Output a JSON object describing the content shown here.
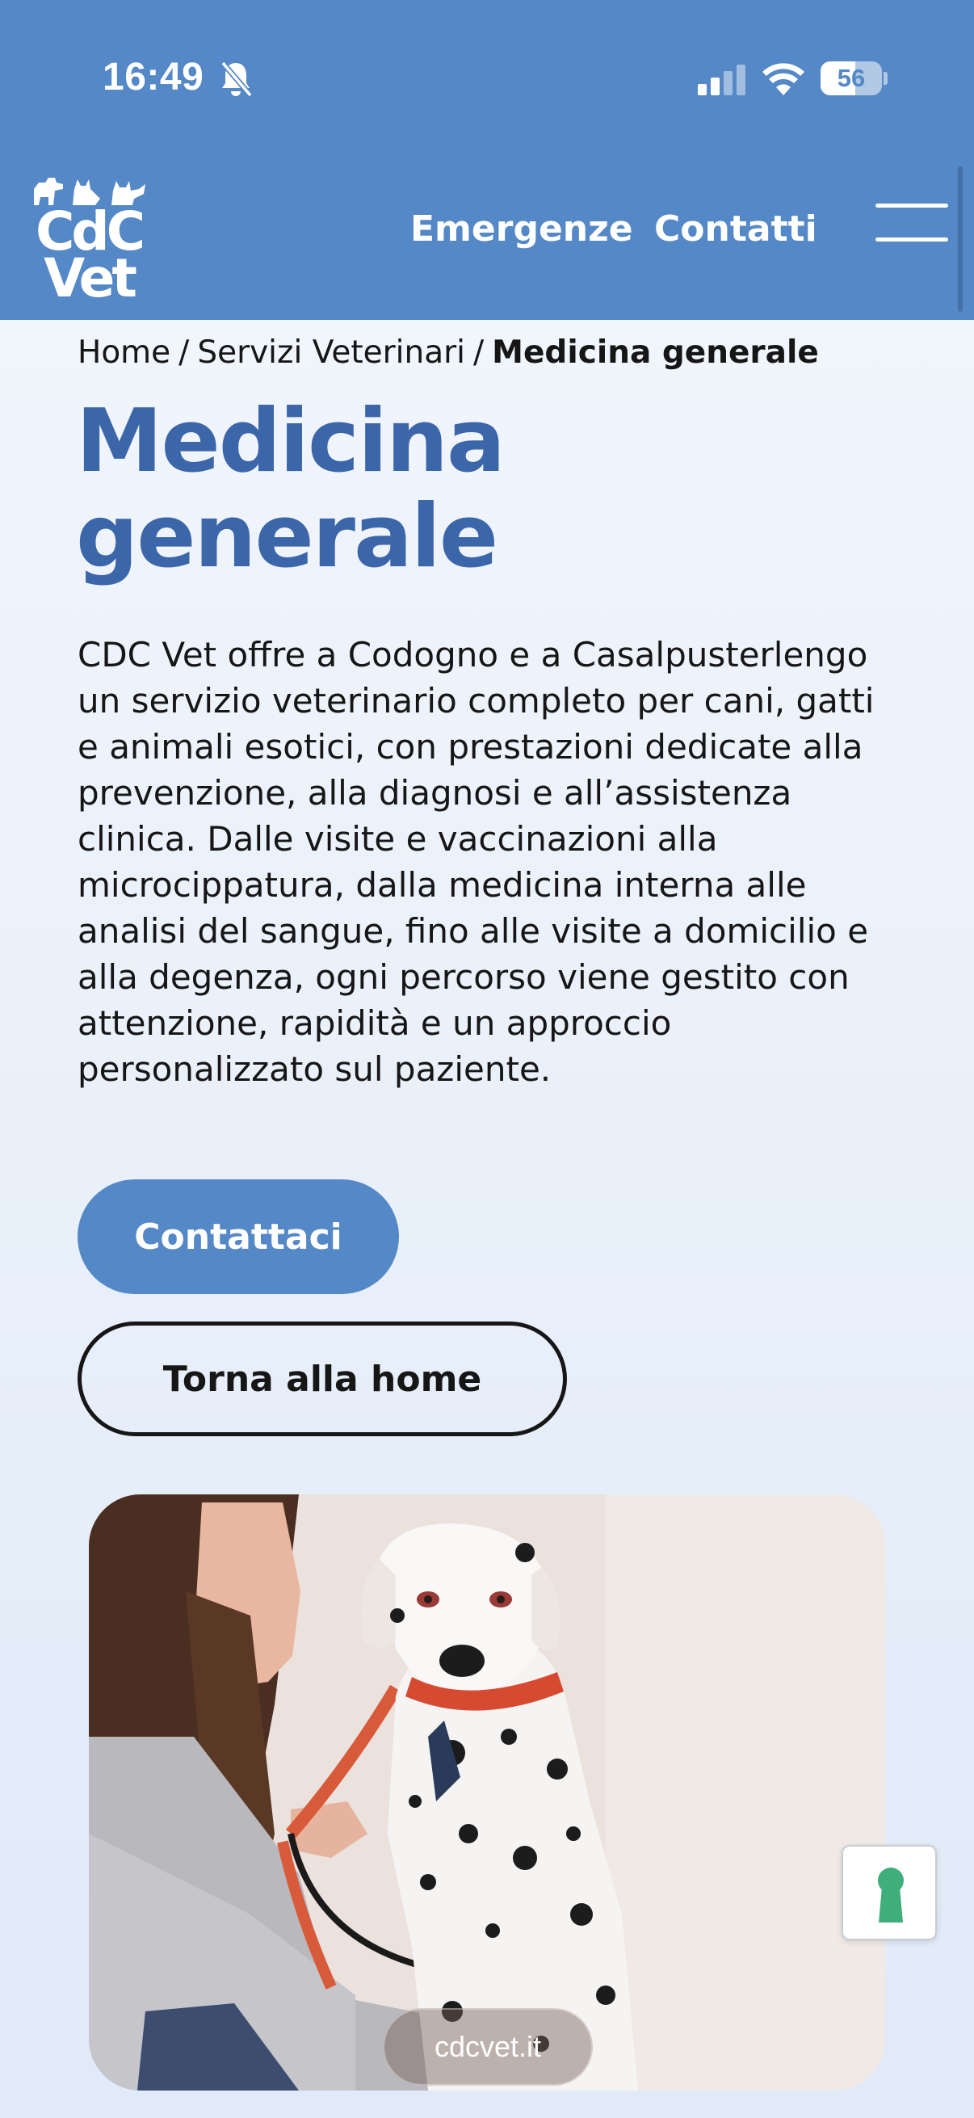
{
  "status_bar": {
    "time": "16:49",
    "battery_percent": "56",
    "icons": [
      "bell-slash-icon",
      "signal-icon",
      "wifi-icon",
      "battery-icon"
    ]
  },
  "header": {
    "logo": {
      "line1": "CdC",
      "line2": "Vet"
    },
    "nav": {
      "emergenze": "Emergenze",
      "contatti": "Contatti"
    },
    "menu_icon": "hamburger-icon"
  },
  "breadcrumb": {
    "home": "Home",
    "separator": "/",
    "section": "Servizi Veterinari",
    "current": "Medicina generale"
  },
  "main": {
    "title": "Medicina generale",
    "intro": "CDC Vet offre a Codogno e a Casalpusterlengo un servizio veterinario completo per cani, gatti e animali esotici, con prestazioni dedicate alla prevenzione, alla diagnosi e all’assistenza clinica. Dalle visite e vaccinazioni alla microcippatura, dalla medicina interna alle analisi del sangue, fino alle visite a domicilio e alla degenza, ogni percorso viene gestito con attenzione, rapidità e un approccio personalizzato sul paziente.",
    "buttons": {
      "contact": "Contattaci",
      "home": "Torna alla home"
    }
  },
  "hero": {
    "url_label": "cdcvet.it"
  },
  "accessibility_widget": {
    "icon": "keyhole-icon"
  },
  "colors": {
    "brand_blue": "#5488c6",
    "title_blue": "#3c66aa",
    "text": "#161616"
  }
}
